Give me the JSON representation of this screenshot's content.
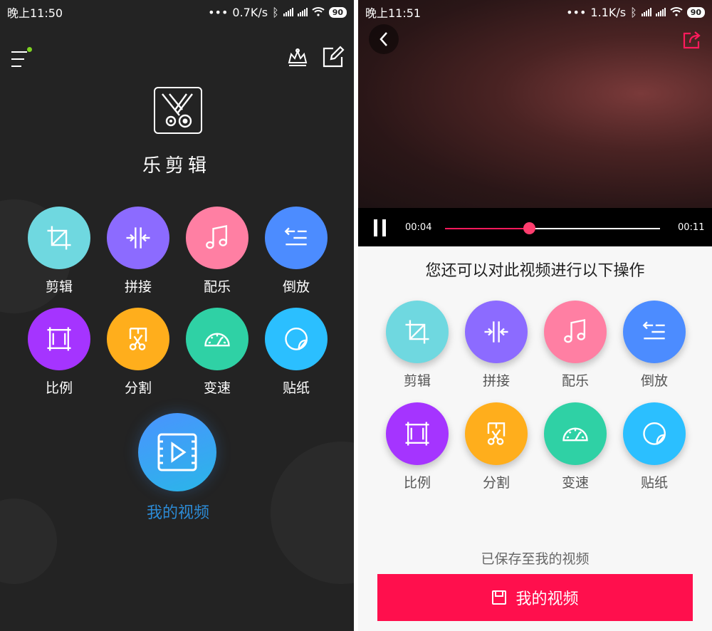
{
  "left": {
    "status": {
      "time": "晚上11:50",
      "dots": "•••",
      "speed": "0.7K/s",
      "battery": "90"
    },
    "app_title": "乐剪辑",
    "tools": [
      {
        "label": "剪辑",
        "icon": "crop-icon",
        "color": "#6fd8e0"
      },
      {
        "label": "拼接",
        "icon": "merge-icon",
        "color": "#8c6bff"
      },
      {
        "label": "配乐",
        "icon": "music-note-icon",
        "color": "#ff7fa3"
      },
      {
        "label": "倒放",
        "icon": "reverse-icon",
        "color": "#4c8cff"
      },
      {
        "label": "比例",
        "icon": "aspect-ratio-icon",
        "color": "#a534ff"
      },
      {
        "label": "分割",
        "icon": "split-cut-icon",
        "color": "#ffae1c"
      },
      {
        "label": "变速",
        "icon": "speedometer-icon",
        "color": "#2fd1a5"
      },
      {
        "label": "贴纸",
        "icon": "sticker-icon",
        "color": "#2bbfff"
      }
    ],
    "my_video": {
      "label": "我的视频",
      "icon": "video-play-icon"
    }
  },
  "right": {
    "status": {
      "time": "晚上11:51",
      "dots": "•••",
      "speed": "1.1K/s",
      "battery": "90"
    },
    "player": {
      "current_time": "00:04",
      "total_time": "00:11",
      "progress": 0.39
    },
    "ops_title": "您还可以对此视频进行以下操作",
    "tools": [
      {
        "label": "剪辑",
        "icon": "crop-icon"
      },
      {
        "label": "拼接",
        "icon": "merge-icon"
      },
      {
        "label": "配乐",
        "icon": "music-note-icon"
      },
      {
        "label": "倒放",
        "icon": "reverse-icon"
      },
      {
        "label": "比例",
        "icon": "aspect-ratio-icon"
      },
      {
        "label": "分割",
        "icon": "split-cut-icon"
      },
      {
        "label": "变速",
        "icon": "speedometer-icon"
      },
      {
        "label": "贴纸",
        "icon": "sticker-icon"
      }
    ],
    "saved_text": "已保存至我的视频",
    "my_video_button": "我的视频"
  },
  "colors": {
    "accent_red": "#ff0f4d",
    "progress": "#ff1a5c",
    "dark_bg": "#232323"
  }
}
